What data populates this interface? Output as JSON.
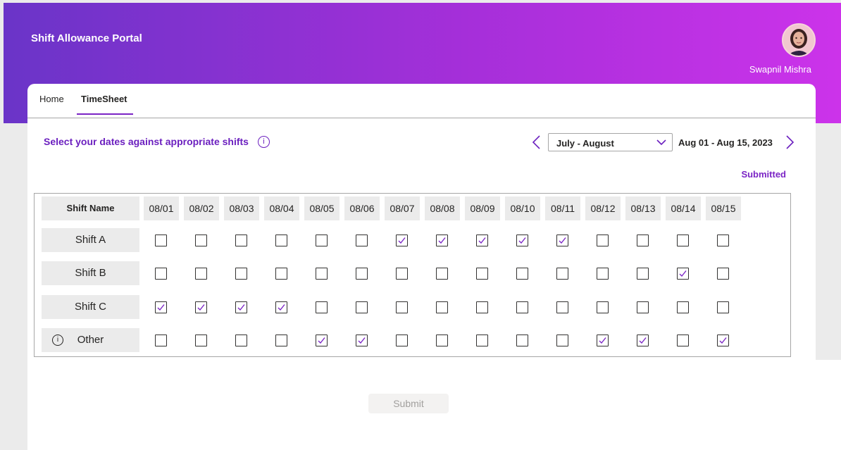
{
  "app": {
    "title": "Shift Allowance Portal"
  },
  "user": {
    "name": "Swapnil Mishra"
  },
  "tabs": [
    {
      "label": "Home",
      "active": false
    },
    {
      "label": "TimeSheet",
      "active": true
    }
  ],
  "timesheet": {
    "instruction": "Select your dates against appropriate shifts",
    "period_selected": "July - August",
    "date_range": "Aug 01 - Aug 15, 2023",
    "status": "Submitted",
    "submit_label": "Submit"
  },
  "grid": {
    "header_label": "Shift Name",
    "dates": [
      "08/01",
      "08/02",
      "08/03",
      "08/04",
      "08/05",
      "08/06",
      "08/07",
      "08/08",
      "08/09",
      "08/10",
      "08/11",
      "08/12",
      "08/13",
      "08/14",
      "08/15"
    ],
    "rows": [
      {
        "label": "Shift A",
        "checked": [
          false,
          false,
          false,
          false,
          false,
          false,
          true,
          true,
          true,
          true,
          true,
          false,
          false,
          false,
          false
        ]
      },
      {
        "label": "Shift B",
        "checked": [
          false,
          false,
          false,
          false,
          false,
          false,
          false,
          false,
          false,
          false,
          false,
          false,
          false,
          true,
          false
        ]
      },
      {
        "label": "Shift C",
        "checked": [
          true,
          true,
          true,
          true,
          false,
          false,
          false,
          false,
          false,
          false,
          false,
          false,
          false,
          false,
          false
        ]
      },
      {
        "label": "Other",
        "checked": [
          false,
          false,
          false,
          false,
          true,
          true,
          false,
          false,
          false,
          false,
          false,
          true,
          true,
          false,
          true
        ]
      }
    ]
  },
  "icons": {
    "info": "info-circle-icon",
    "prev": "chevron-left-icon",
    "next": "chevron-right-icon",
    "dropdown": "chevron-down-icon",
    "check": "checkmark-icon"
  },
  "colors": {
    "accent": "#7b24c5",
    "header_start": "#6a34c8",
    "header_end": "#cc33ea"
  }
}
